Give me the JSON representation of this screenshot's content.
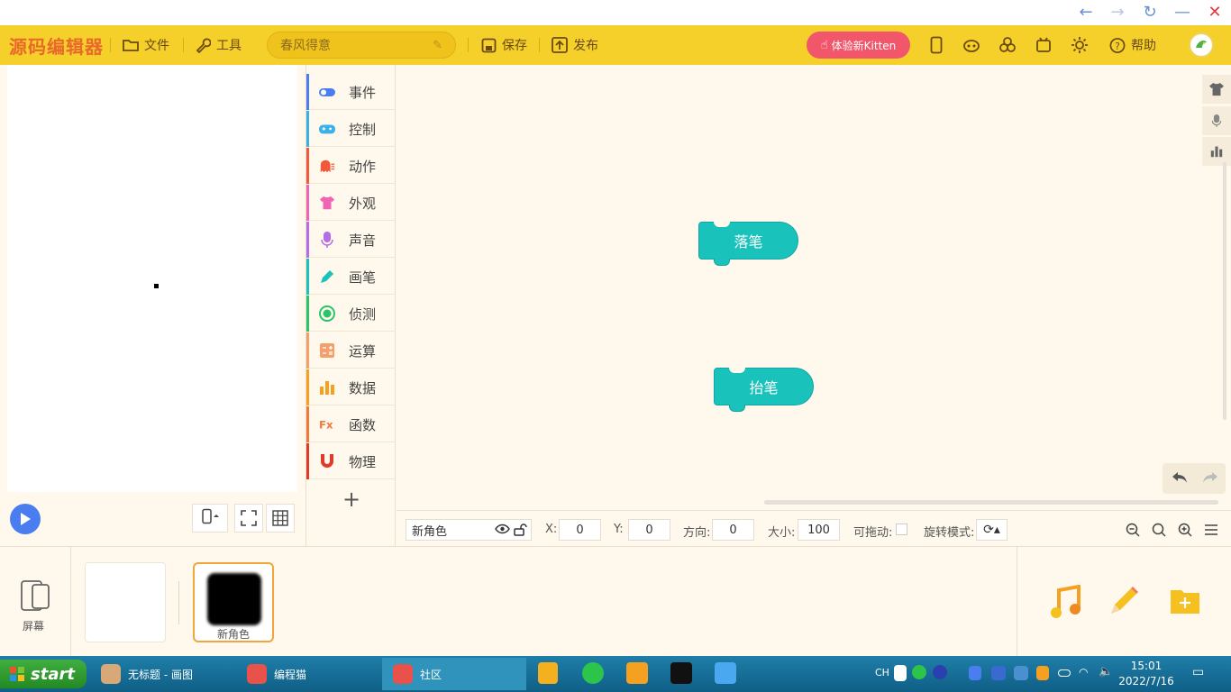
{
  "app": {
    "logo": "源码编辑器",
    "menu_file": "文件",
    "menu_tools": "工具",
    "project_name": "春风得意",
    "save": "保存",
    "publish": "发布",
    "kitten_button": "体验新Kitten",
    "help": "帮助",
    "accent_color": "#f5cf2a"
  },
  "categories": [
    {
      "label": "事件",
      "color": "#4a7ef0",
      "icon": "toggle-icon"
    },
    {
      "label": "控制",
      "color": "#3ab2e8",
      "icon": "gamepad-icon"
    },
    {
      "label": "动作",
      "color": "#f05a3a",
      "icon": "ghost-icon"
    },
    {
      "label": "外观",
      "color": "#f064b4",
      "icon": "shirt-icon"
    },
    {
      "label": "声音",
      "color": "#b56ce6",
      "icon": "microphone-icon"
    },
    {
      "label": "画笔",
      "color": "#19c3bb",
      "icon": "pen-icon"
    },
    {
      "label": "侦测",
      "color": "#2cc46a",
      "icon": "target-icon"
    },
    {
      "label": "运算",
      "color": "#f5a06a",
      "icon": "calculator-icon"
    },
    {
      "label": "数据",
      "color": "#f5a020",
      "icon": "bar-chart-icon"
    },
    {
      "label": "函数",
      "color": "#f07a3a",
      "icon": "function-icon"
    },
    {
      "label": "物理",
      "color": "#e03a2a",
      "icon": "magnet-icon"
    }
  ],
  "blocks": [
    {
      "label": "落笔"
    },
    {
      "label": "抬笔"
    }
  ],
  "props": {
    "sprite_name": "新角色",
    "x_label": "X:",
    "x_value": "0",
    "y_label": "Y:",
    "y_value": "0",
    "direction_label": "方向:",
    "direction_value": "0",
    "size_label": "大小:",
    "size_value": "100",
    "draggable_label": "可拖动:",
    "rotation_label": "旋转模式:"
  },
  "sprites": {
    "screen_label": "屏幕",
    "sprite_name": "新角色"
  },
  "taskbar": {
    "start": "start",
    "tasks": [
      {
        "label": "无标题 - 画图"
      },
      {
        "label": "编程猫"
      },
      {
        "label": "社区"
      }
    ],
    "ime": "CH",
    "time": "15:01",
    "date": "2022/7/16"
  }
}
